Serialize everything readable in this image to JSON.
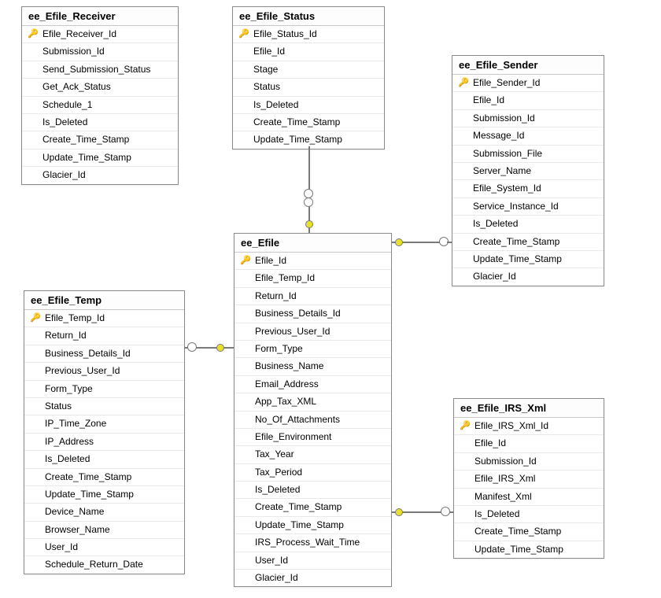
{
  "entities": {
    "receiver": {
      "title": "ee_Efile_Receiver",
      "pk_index": 0,
      "columns": [
        "Efile_Receiver_Id",
        "Submission_Id",
        "Send_Submission_Status",
        "Get_Ack_Status",
        "Schedule_1",
        "Is_Deleted",
        "Create_Time_Stamp",
        "Update_Time_Stamp",
        "Glacier_Id"
      ]
    },
    "status": {
      "title": "ee_Efile_Status",
      "pk_index": 0,
      "columns": [
        "Efile_Status_Id",
        "Efile_Id",
        "Stage",
        "Status",
        "Is_Deleted",
        "Create_Time_Stamp",
        "Update_Time_Stamp"
      ]
    },
    "sender": {
      "title": "ee_Efile_Sender",
      "pk_index": 0,
      "columns": [
        "Efile_Sender_Id",
        "Efile_Id",
        "Submission_Id",
        "Message_Id",
        "Submission_File",
        "Server_Name",
        "Efile_System_Id",
        "Service_Instance_Id",
        "Is_Deleted",
        "Create_Time_Stamp",
        "Update_Time_Stamp",
        "Glacier_Id"
      ]
    },
    "efile": {
      "title": "ee_Efile",
      "pk_index": 0,
      "columns": [
        "Efile_Id",
        "Efile_Temp_Id",
        "Return_Id",
        "Business_Details_Id",
        "Previous_User_Id",
        "Form_Type",
        "Business_Name",
        "Email_Address",
        "App_Tax_XML",
        "No_Of_Attachments",
        "Efile_Environment",
        "Tax_Year",
        "Tax_Period",
        "Is_Deleted",
        "Create_Time_Stamp",
        "Update_Time_Stamp",
        "IRS_Process_Wait_Time",
        "User_Id",
        "Glacier_Id"
      ]
    },
    "temp": {
      "title": "ee_Efile_Temp",
      "pk_index": 0,
      "columns": [
        "Efile_Temp_Id",
        "Return_Id",
        "Business_Details_Id",
        "Previous_User_Id",
        "Form_Type",
        "Status",
        "IP_Time_Zone",
        "IP_Address",
        "Is_Deleted",
        "Create_Time_Stamp",
        "Update_Time_Stamp",
        "Device_Name",
        "Browser_Name",
        "User_Id",
        "Schedule_Return_Date"
      ]
    },
    "irsxml": {
      "title": "ee_Efile_IRS_Xml",
      "pk_index": 0,
      "columns": [
        "Efile_IRS_Xml_Id",
        "Efile_Id",
        "Submission_Id",
        "Efile_IRS_Xml",
        "Manifest_Xml",
        "Is_Deleted",
        "Create_Time_Stamp",
        "Update_Time_Stamp"
      ]
    }
  },
  "relationships": [
    {
      "from": "status",
      "to": "efile",
      "note": "Efile_Id FK"
    },
    {
      "from": "sender",
      "to": "efile",
      "note": "Efile_Id FK"
    },
    {
      "from": "irsxml",
      "to": "efile",
      "note": "Efile_Id FK"
    },
    {
      "from": "temp",
      "to": "efile",
      "note": "Efile_Temp_Id FK"
    }
  ]
}
